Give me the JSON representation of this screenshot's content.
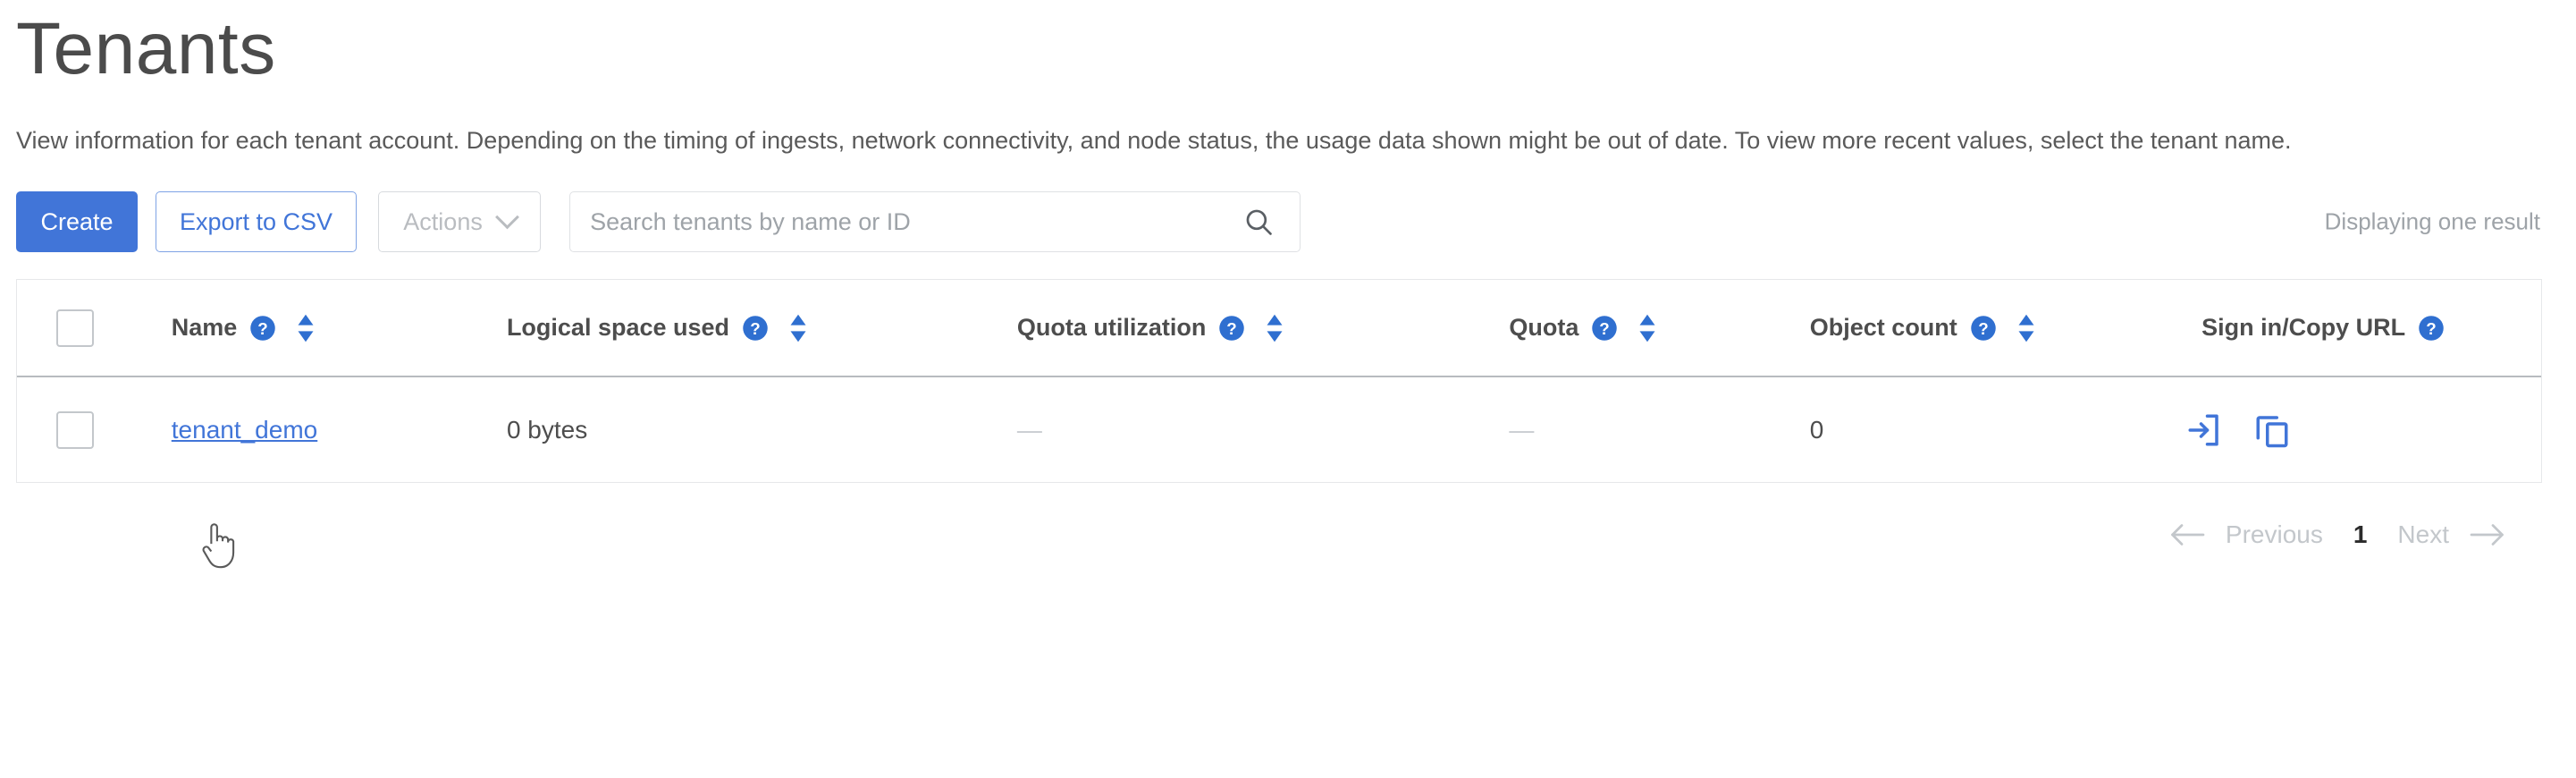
{
  "page": {
    "title": "Tenants",
    "description": "View information for each tenant account. Depending on the timing of ingests, network connectivity, and node status, the usage data shown might be out of date. To view more recent values, select the tenant name."
  },
  "toolbar": {
    "create_label": "Create",
    "export_label": "Export to CSV",
    "actions_label": "Actions",
    "actions_chevron_icon": "chevron-down-icon",
    "search": {
      "placeholder": "Search tenants by name or ID",
      "value": "",
      "icon": "search-icon"
    },
    "results_text": "Displaying one result"
  },
  "table": {
    "select_all_icon": "checkbox-unchecked-icon",
    "help_icon": "help-circle-icon",
    "sort_icon": "sort-arrows-icon",
    "columns": [
      {
        "label": "Name",
        "help": true,
        "sortable": true
      },
      {
        "label": "Logical space used",
        "help": true,
        "sortable": true
      },
      {
        "label": "Quota utilization",
        "help": true,
        "sortable": true
      },
      {
        "label": "Quota",
        "help": true,
        "sortable": true
      },
      {
        "label": "Object count",
        "help": true,
        "sortable": true
      },
      {
        "label": "Sign in/Copy URL",
        "help": true,
        "sortable": false
      }
    ],
    "rows": [
      {
        "name": "tenant_demo",
        "logical_space_used": "0 bytes",
        "quota_utilization": "—",
        "quota": "—",
        "object_count": "0",
        "sign_in_icon": "sign-in-icon",
        "copy_url_icon": "copy-icon"
      }
    ]
  },
  "pagination": {
    "previous_label": "Previous",
    "next_label": "Next",
    "current_page": "1",
    "prev_arrow_icon": "arrow-left-icon",
    "next_arrow_icon": "arrow-right-icon"
  },
  "colors": {
    "accent_blue": "#4175d8",
    "link_blue": "#4175d8",
    "text_dark": "#4d4d4d",
    "muted": "#9ea3a8"
  }
}
